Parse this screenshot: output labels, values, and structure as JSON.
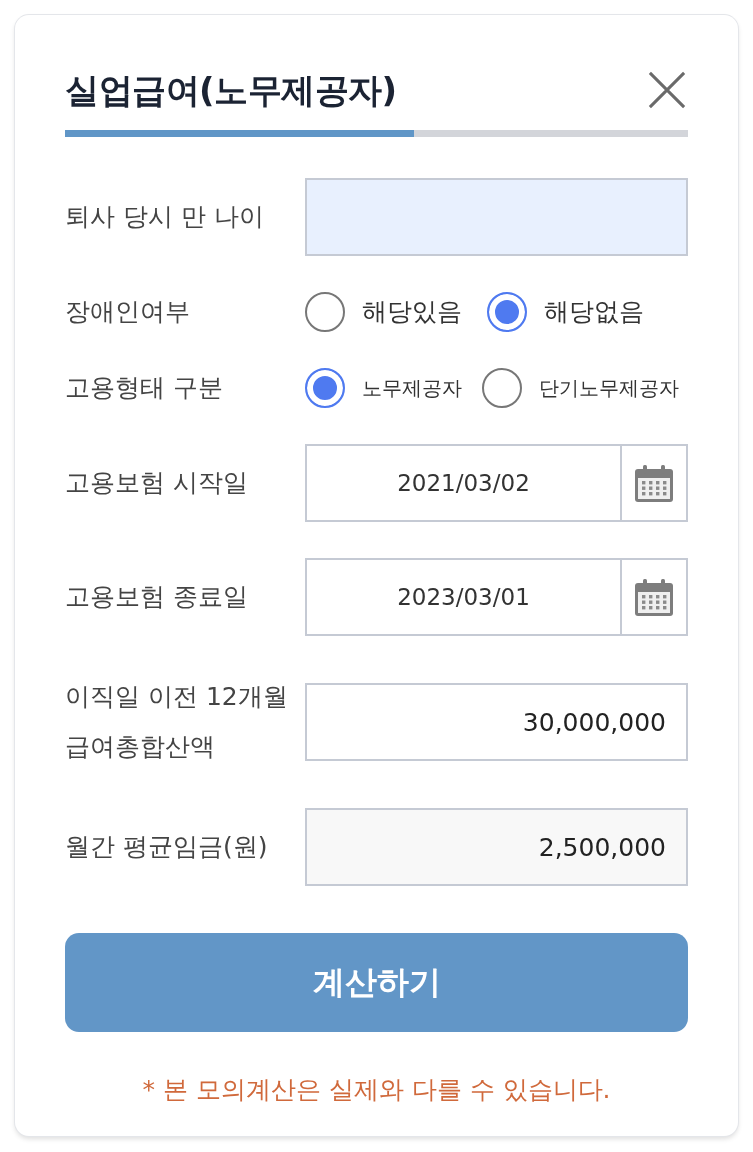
{
  "dialog": {
    "title": "실업급여(노무제공자)",
    "progress": {
      "level": 0.56
    }
  },
  "fields": [
    {
      "kind": "text",
      "label": "퇴사 당시 만 나이",
      "autofilled": true
    },
    {
      "kind": "radio",
      "label": "장애인여부",
      "options": [
        {
          "label": "해당있음",
          "selected": false
        },
        {
          "label": "해당없음",
          "selected": true
        }
      ]
    },
    {
      "kind": "radio",
      "label": "고용형태 구분",
      "options": [
        {
          "label": "노무제공자",
          "selected": true
        },
        {
          "label": "단기노무제공자",
          "selected": false
        }
      ]
    },
    {
      "kind": "date",
      "label": "고용보험 시작일",
      "value": "2021/03/02"
    },
    {
      "kind": "date",
      "label": "고용보험 종료일",
      "value": "2023/03/01"
    },
    {
      "kind": "text",
      "label": "이직일 이전 12개월 급여총합산액",
      "value": "30,000,000",
      "autofilled": false
    },
    {
      "kind": "readonly",
      "label": "월간 평균임금(원)",
      "value": "2,500,000"
    }
  ],
  "calculate_button": {
    "label": "계산하기"
  },
  "notice": "* 본 모의계산은 실제와 다를 수 있습니다."
}
